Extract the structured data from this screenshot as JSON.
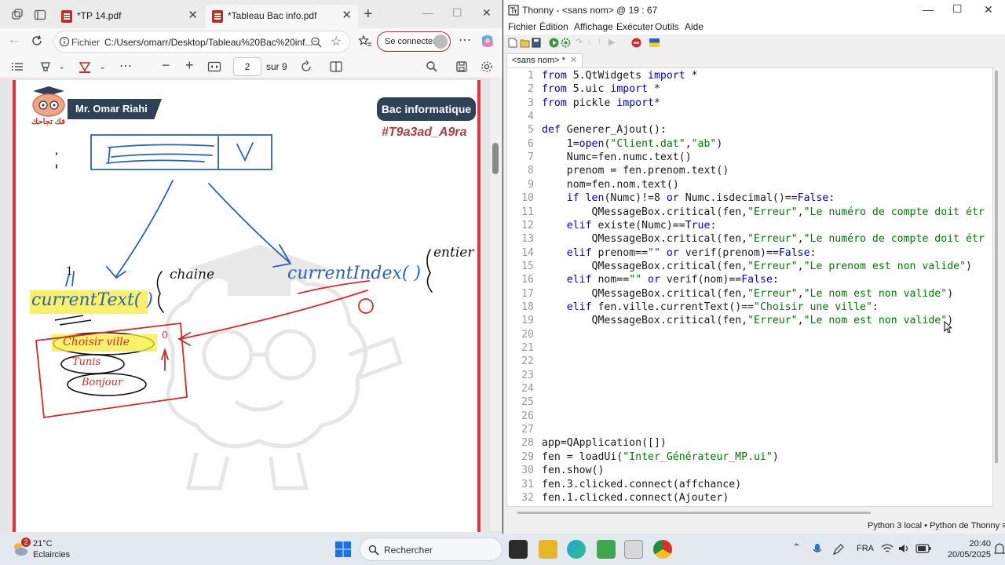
{
  "edge": {
    "tabs": [
      {
        "label": "*TP 14.pdf"
      },
      {
        "label": "*Tableau Bac info.pdf"
      }
    ],
    "address": {
      "scheme_label": "Fichier",
      "url": "C:/Users/omarr/Desktop/Tableau%20Bac%20inf..."
    },
    "signin_label": "Se connecter",
    "pdf_toolbar": {
      "page_current": "2",
      "page_total": "sur 9"
    }
  },
  "pdf_content": {
    "author": "Mr. Omar Riahi",
    "logo_text": "فك تجاحك",
    "badge": "Bac informatique",
    "hashtag": "#T9a3ad_A9ra",
    "handwriting": {
      "current_text": "currentText( )",
      "chaine": "chaine",
      "current_index": "currentIndex( )",
      "entier": "entier",
      "combo_items": [
        "Choisir ville",
        "Tunis",
        "Bonjour"
      ],
      "marker_index": "0",
      "marker_arrow": "1"
    }
  },
  "thonny": {
    "title": "Thonny  -  <sans nom>  @  19 : 67",
    "menu": [
      "Fichier",
      "Édition",
      "Affichage",
      "Exécuter",
      "Outils",
      "Aide"
    ],
    "tab_label": "<sans nom> *",
    "lines": [
      {
        "n": "1",
        "code": "from PyQt5.QtWidgets import *"
      },
      {
        "n": "2",
        "code": "from PyQt5.uic import *"
      },
      {
        "n": "3",
        "code": "from pickle import*"
      },
      {
        "n": "4",
        "code": ""
      },
      {
        "n": "5",
        "code": "def Generer_Ajout():"
      },
      {
        "n": "6",
        "code": "    f1=open(\"Client.dat\",\"ab\")"
      },
      {
        "n": "7",
        "code": "    Numc=fen.numc.text()"
      },
      {
        "n": "8",
        "code": "    prenom = fen.prenom.text()"
      },
      {
        "n": "9",
        "code": "    nom=fen.nom.text()"
      },
      {
        "n": "10",
        "code": "    if len(Numc)!=8 or Numc.isdecimal()==False:"
      },
      {
        "n": "11",
        "code": "        QMessageBox.critical(fen,\"Erreur\",\"Le numéro de compte doit étr"
      },
      {
        "n": "12",
        "code": "    elif existe(Numc)==True:"
      },
      {
        "n": "13",
        "code": "        QMessageBox.critical(fen,\"Erreur\",\"Le numéro de compte doit étr"
      },
      {
        "n": "14",
        "code": "    elif prenom==\"\" or verif(prenom)==False:"
      },
      {
        "n": "15",
        "code": "        QMessageBox.critical(fen,\"Erreur\",\"Le prenom est non valide\")"
      },
      {
        "n": "16",
        "code": "    elif nom==\"\" or verif(nom)==False:"
      },
      {
        "n": "17",
        "code": "        QMessageBox.critical(fen,\"Erreur\",\"Le nom est non valide\")"
      },
      {
        "n": "18",
        "code": "    elif fen.ville.currentText()==\"Choisir une ville\":"
      },
      {
        "n": "19",
        "code": "        QMessageBox.critical(fen,\"Erreur\",\"Le nom est non valide\")"
      },
      {
        "n": "20",
        "code": ""
      },
      {
        "n": "21",
        "code": ""
      },
      {
        "n": "22",
        "code": ""
      },
      {
        "n": "23",
        "code": ""
      },
      {
        "n": "24",
        "code": ""
      },
      {
        "n": "25",
        "code": ""
      },
      {
        "n": "26",
        "code": ""
      },
      {
        "n": "27",
        "code": ""
      },
      {
        "n": "28",
        "code": "app=QApplication([])"
      },
      {
        "n": "29",
        "code": "fen = loadUi(\"Inter_Générateur_MP.ui\")"
      },
      {
        "n": "30",
        "code": "fen.show()"
      },
      {
        "n": "31",
        "code": "fen.b3.clicked.connect(affchance)"
      },
      {
        "n": "32",
        "code": "fen.b1.clicked.connect(Ajouter)"
      }
    ],
    "status": "Python 3 local  •  Python de Thonny  ≡"
  },
  "taskbar": {
    "weather_badge": "2",
    "temperature": "21°C",
    "weather": "Eclaircies",
    "search_placeholder": "Rechercher",
    "lang": "FRA",
    "time": "20:40",
    "date": "20/05/2025"
  },
  "colors": {
    "keyword": "#0000cc",
    "string": "#007a00",
    "pdf_border": "#e0343e",
    "banner": "#2d4157",
    "hashtag": "#b03a4a",
    "ink_blue": "#2a62b8",
    "ink_red": "#d42a2a",
    "highlight": "#f5ec3a"
  }
}
